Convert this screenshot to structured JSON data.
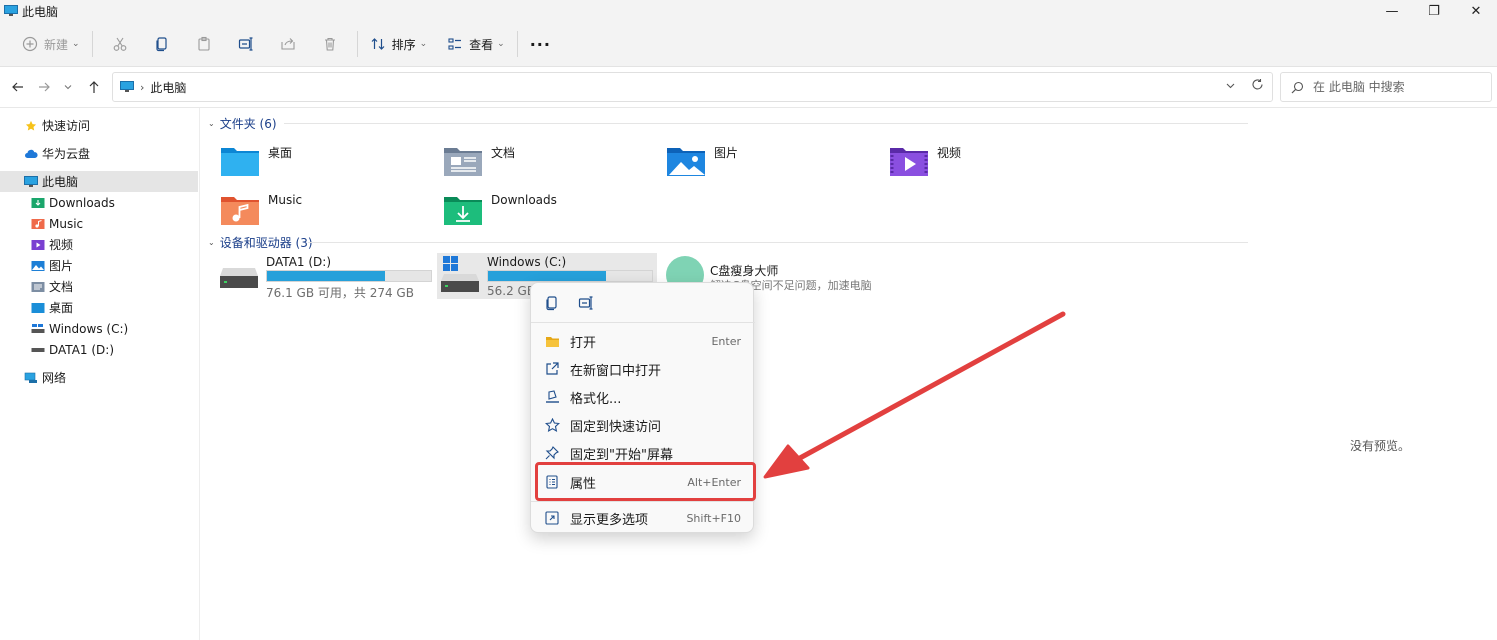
{
  "window": {
    "title": "此电脑",
    "controls": {
      "minimize": "—",
      "maximize": "❐",
      "close": "✕"
    }
  },
  "toolbar": {
    "new_label": "新建",
    "sort_label": "排序",
    "view_label": "查看",
    "more_label": "···"
  },
  "address": {
    "crumb": "此电脑",
    "separator": "›"
  },
  "search": {
    "placeholder": "在 此电脑 中搜索"
  },
  "sidebar": {
    "items": [
      {
        "label": "快速访问",
        "icon": "star-icon"
      },
      {
        "label": "华为云盘",
        "icon": "cloud-icon"
      },
      {
        "label": "此电脑",
        "icon": "computer-icon"
      },
      {
        "label": "Downloads",
        "icon": "downloads-icon"
      },
      {
        "label": "Music",
        "icon": "music-icon"
      },
      {
        "label": "视频",
        "icon": "video-icon"
      },
      {
        "label": "图片",
        "icon": "pictures-icon"
      },
      {
        "label": "文档",
        "icon": "documents-icon"
      },
      {
        "label": "桌面",
        "icon": "desktop-icon"
      },
      {
        "label": "Windows (C:)",
        "icon": "drive-c-icon"
      },
      {
        "label": "DATA1 (D:)",
        "icon": "drive-d-icon"
      },
      {
        "label": "网络",
        "icon": "network-icon"
      }
    ]
  },
  "folders": {
    "header": "文件夹 (6)",
    "items": [
      {
        "label": "桌面"
      },
      {
        "label": "文档"
      },
      {
        "label": "图片"
      },
      {
        "label": "视频"
      },
      {
        "label": "Music"
      },
      {
        "label": "Downloads"
      }
    ]
  },
  "devices": {
    "header": "设备和驱动器 (3)",
    "drives": [
      {
        "name": "DATA1 (D:)",
        "info": "76.1 GB 可用，共 274 GB",
        "used_fraction": 0.72
      },
      {
        "name": "Windows (C:)",
        "info": "56.2 GB",
        "used_fraction": 0.72
      }
    ],
    "app": {
      "name": "C盘瘦身大师",
      "desc": "解决C盘空间不足问题，加速电脑"
    }
  },
  "preview": {
    "empty_text": "没有预览。"
  },
  "context_menu": {
    "items": [
      {
        "label": "打开",
        "shortcut": "Enter"
      },
      {
        "label": "在新窗口中打开",
        "shortcut": ""
      },
      {
        "label": "格式化...",
        "shortcut": ""
      },
      {
        "label": "固定到快速访问",
        "shortcut": ""
      },
      {
        "label": "固定到\"开始\"屏幕",
        "shortcut": ""
      },
      {
        "label": "属性",
        "shortcut": "Alt+Enter"
      },
      {
        "label": "显示更多选项",
        "shortcut": "Shift+F10"
      }
    ]
  },
  "colors": {
    "accent": "#26a0da",
    "annotation": "#e2403f",
    "group_header": "#1b3f8a"
  }
}
